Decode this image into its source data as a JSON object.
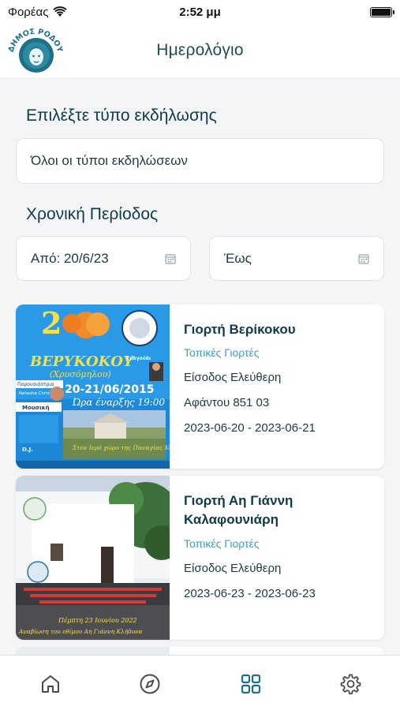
{
  "status_bar": {
    "carrier": "Φορέας",
    "time": "2:52 μμ"
  },
  "header": {
    "title": "Ημερολόγιο",
    "logo_text": "ΔΗΜΟΣ ΡΟΔΟΥ"
  },
  "filters": {
    "event_type_label": "Επιλέξτε τύπο εκδήλωσης",
    "event_type_value": "Όλοι οι τύποι εκδηλώσεων",
    "period_label": "Χρονική Περίοδος",
    "from_value": "Από: 20/6/23",
    "to_placeholder": "Έως"
  },
  "events": [
    {
      "title": "Γιορτή Βερίκοκου",
      "category": "Τοπικές Γιορτές",
      "entry": "Είσοδος Ελεύθερη",
      "location": "Αφάντου 851 03",
      "dates": "2023-06-20 - 2023-06-21",
      "poster": {
        "number": "2",
        "title": "ΒΕΡΥΚΟΚΟΥ",
        "subtitle": "(Χρυσόμηλου)",
        "date": "20-21/06/2015",
        "time": "Ώρα έναρξης 19:00",
        "place": "Στον Ιερό χώρο της Παναγίας Καθολικής",
        "presenter_label": "Παρουσιάστρια",
        "presenter_name": "Natasha Christofis",
        "music_label": "Μουσική",
        "dj_label": "D.J.",
        "singer_label": "Τραγούδι"
      }
    },
    {
      "title": "Γιορτή Αη Γιάννη Καλαφουνιάρη",
      "category": "Τοπικές Γιορτές",
      "entry": "Είσοδος Ελεύθερη",
      "dates": "2023-06-23 - 2023-06-23",
      "poster": {
        "date": "Πέμπτη 23 Ιουνίου 2022",
        "caption": "Αναβίωση του εθίμου Αη Γιάννη Κλήδονα"
      }
    }
  ],
  "tab_bar": {
    "items": [
      "home-icon",
      "compass-icon",
      "grid-icon",
      "settings-icon"
    ],
    "active_index": 2
  },
  "colors": {
    "primary": "#0f3b4a",
    "accent": "#3a9ec1",
    "active_tab": "#1d6e86",
    "background": "#f4f5f7"
  }
}
